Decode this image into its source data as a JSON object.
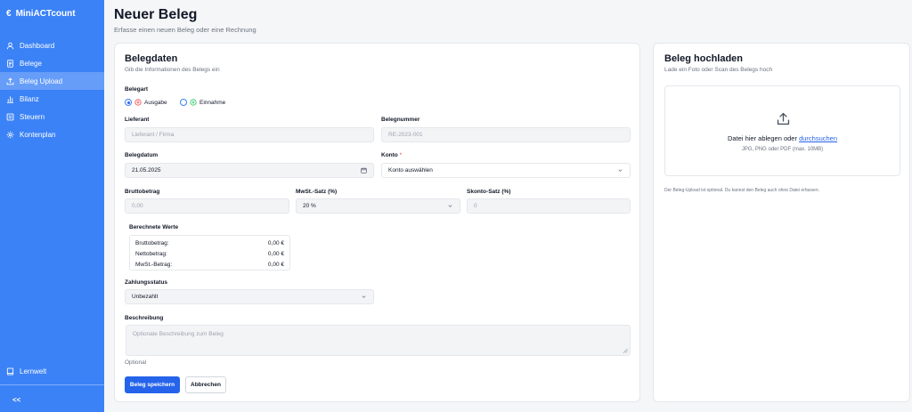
{
  "app": {
    "brand": "MiniACTcount",
    "brand_icon": "euro-icon",
    "collapse_label": "<<"
  },
  "sidebar": {
    "items": [
      {
        "label": "Dashboard",
        "icon": "user-icon"
      },
      {
        "label": "Belege",
        "icon": "document-icon"
      },
      {
        "label": "Beleg Upload",
        "icon": "upload-icon",
        "active": true
      },
      {
        "label": "Bilanz",
        "icon": "bar-chart-icon"
      },
      {
        "label": "Steuern",
        "icon": "file-icon"
      },
      {
        "label": "Kontenplan",
        "icon": "gear-icon"
      }
    ],
    "bottom_items": [
      {
        "label": "Lernwelt",
        "icon": "book-icon"
      }
    ]
  },
  "header": {
    "title": "Neuer Beleg",
    "subtitle": "Erfasse einen neuen Beleg oder eine Rechnung"
  },
  "form": {
    "title": "Belegdaten",
    "subtitle": "Gib die Informationen des Belegs ein",
    "belegart": {
      "label": "Belegart",
      "options": [
        {
          "label": "Ausgabe",
          "selected": true
        },
        {
          "label": "Einnahme",
          "selected": false
        }
      ]
    },
    "lieferant": {
      "label": "Lieferant",
      "placeholder": "Lieferant / Firma"
    },
    "belegnummer": {
      "label": "Belegnummer",
      "placeholder": "RE-2023-001"
    },
    "belegdatum": {
      "label": "Belegdatum",
      "value": "21.05.2025"
    },
    "konto": {
      "label": "Konto",
      "required_mark": "*",
      "value": "Konto auswählen"
    },
    "bruttobetrag": {
      "label": "Bruttobetrag",
      "placeholder": "0,00"
    },
    "mwst": {
      "label": "MwSt.-Satz (%)",
      "value": "20 %"
    },
    "skonto": {
      "label": "Skonto-Satz (%)",
      "placeholder": "0"
    },
    "berechnete": {
      "label": "Berechnete Werte",
      "rows": [
        {
          "label": "Bruttobetrag:",
          "value": "0,00 €"
        },
        {
          "label": "Nettobetrag:",
          "value": "0,00 €"
        },
        {
          "label": "MwSt.-Betrag:",
          "value": "0,00 €"
        }
      ]
    },
    "zahlungsstatus": {
      "label": "Zahlungsstatus",
      "value": "Unbezahlt"
    },
    "beschreibung": {
      "label": "Beschreibung",
      "placeholder": "Optionale Beschreibung zum Beleg",
      "hint": "Optional"
    },
    "save_label": "Beleg speichern",
    "cancel_label": "Abbrechen"
  },
  "upload": {
    "title": "Beleg hochladen",
    "subtitle": "Lade ein Foto oder Scan des Belegs hoch",
    "drop_text": "Datei hier ablegen oder",
    "browse_link": "durchsuchen",
    "formats_hint": "JPG, PNG oder PDF (max. 10MB)",
    "note": "Der Beleg-Upload ist optional. Du kannst den Beleg auch ohne Datei erfassen."
  },
  "colors": {
    "sidebar": "#3b82f6",
    "primary": "#2563eb",
    "required": "#ef4444",
    "ausgabe_icon": "#ef4444",
    "einnahme_icon": "#22c55e"
  }
}
